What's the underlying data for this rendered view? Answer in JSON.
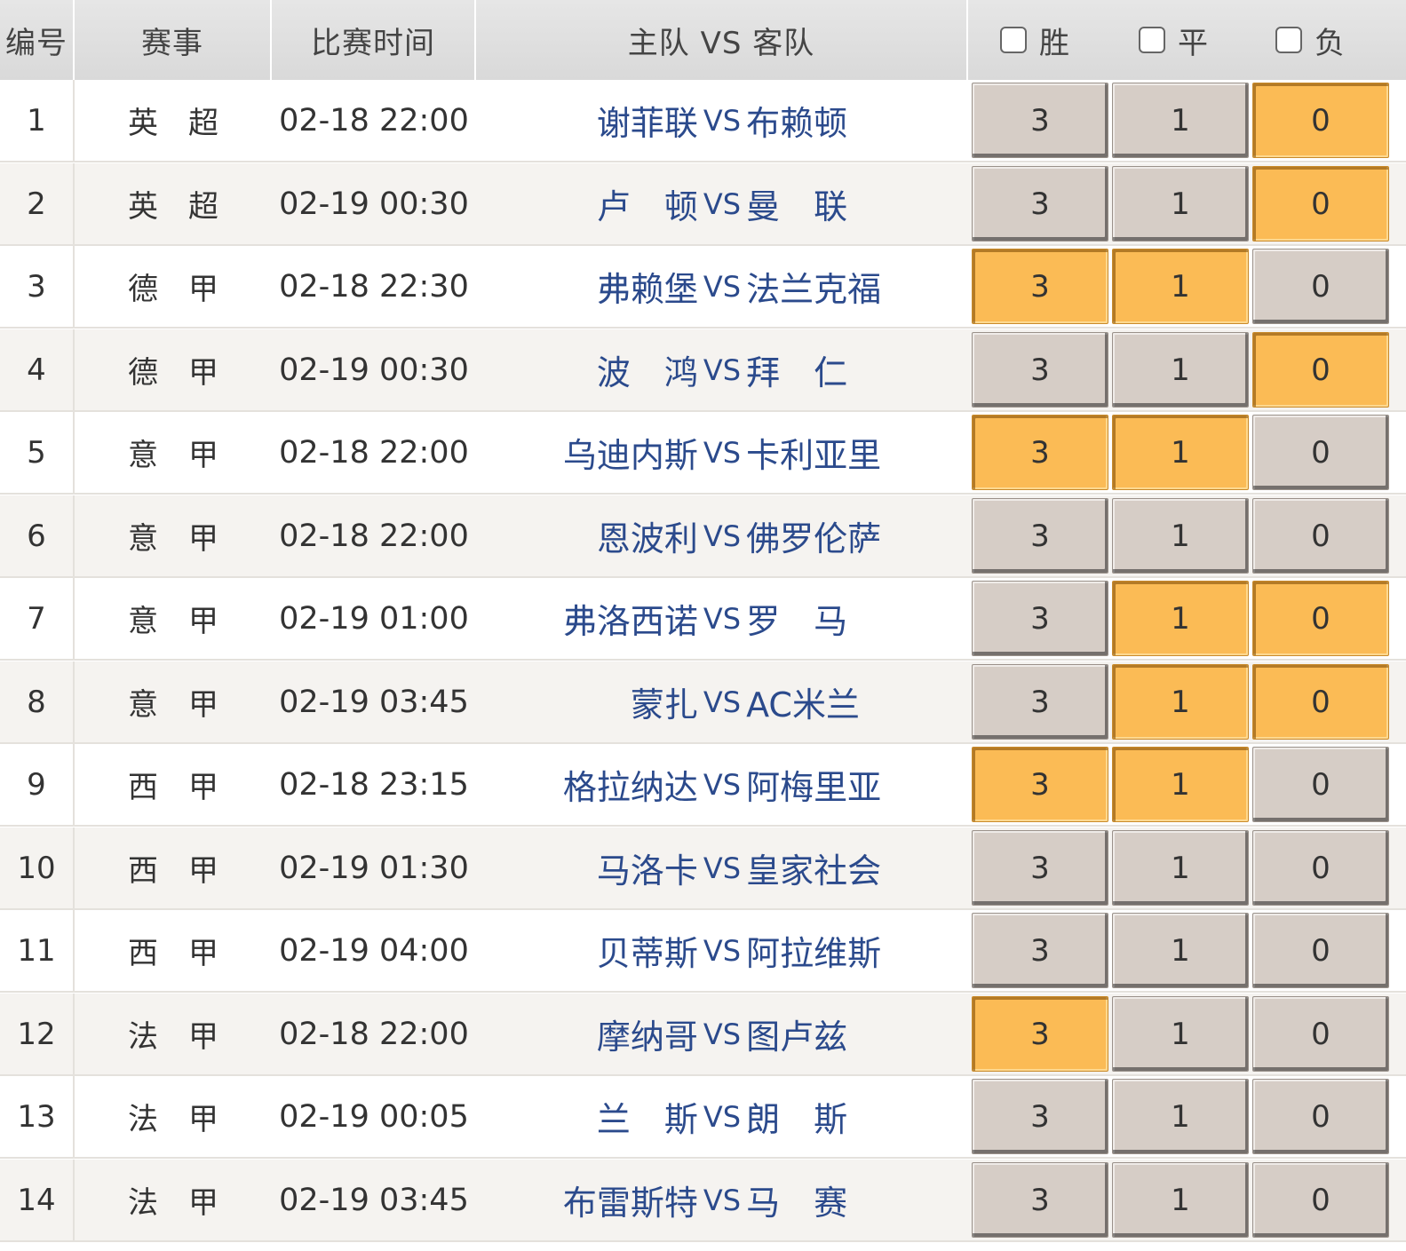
{
  "header": {
    "number": "编号",
    "league": "赛事",
    "time": "比赛时间",
    "match": "主队 VS 客队",
    "win": "胜",
    "draw": "平",
    "loss": "负"
  },
  "vs_text": "VS",
  "colors": {
    "selected": "#fbbb55",
    "unselected": "#d6cdc6",
    "team_text": "#2b4a8c",
    "header_bg": "#dcdcdc"
  },
  "rows": [
    {
      "no": "1",
      "league": "英超",
      "time": "02-18 22:00",
      "home": "谢菲联",
      "away": "布赖顿",
      "win": "3",
      "draw": "1",
      "loss": "0",
      "selected": [
        false,
        false,
        true
      ]
    },
    {
      "no": "2",
      "league": "英超",
      "time": "02-19 00:30",
      "home": "卢　顿",
      "away": "曼　联",
      "win": "3",
      "draw": "1",
      "loss": "0",
      "selected": [
        false,
        false,
        true
      ]
    },
    {
      "no": "3",
      "league": "德甲",
      "time": "02-18 22:30",
      "home": "弗赖堡",
      "away": "法兰克福",
      "win": "3",
      "draw": "1",
      "loss": "0",
      "selected": [
        true,
        true,
        false
      ]
    },
    {
      "no": "4",
      "league": "德甲",
      "time": "02-19 00:30",
      "home": "波　鸿",
      "away": "拜　仁",
      "win": "3",
      "draw": "1",
      "loss": "0",
      "selected": [
        false,
        false,
        true
      ]
    },
    {
      "no": "5",
      "league": "意甲",
      "time": "02-18 22:00",
      "home": "乌迪内斯",
      "away": "卡利亚里",
      "win": "3",
      "draw": "1",
      "loss": "0",
      "selected": [
        true,
        true,
        false
      ]
    },
    {
      "no": "6",
      "league": "意甲",
      "time": "02-18 22:00",
      "home": "恩波利",
      "away": "佛罗伦萨",
      "win": "3",
      "draw": "1",
      "loss": "0",
      "selected": [
        false,
        false,
        false
      ]
    },
    {
      "no": "7",
      "league": "意甲",
      "time": "02-19 01:00",
      "home": "弗洛西诺",
      "away": "罗　马",
      "win": "3",
      "draw": "1",
      "loss": "0",
      "selected": [
        false,
        true,
        true
      ]
    },
    {
      "no": "8",
      "league": "意甲",
      "time": "02-19 03:45",
      "home": "蒙扎",
      "away": "AC米兰",
      "win": "3",
      "draw": "1",
      "loss": "0",
      "selected": [
        false,
        true,
        true
      ]
    },
    {
      "no": "9",
      "league": "西甲",
      "time": "02-18 23:15",
      "home": "格拉纳达",
      "away": "阿梅里亚",
      "win": "3",
      "draw": "1",
      "loss": "0",
      "selected": [
        true,
        true,
        false
      ]
    },
    {
      "no": "10",
      "league": "西甲",
      "time": "02-19 01:30",
      "home": "马洛卡",
      "away": "皇家社会",
      "win": "3",
      "draw": "1",
      "loss": "0",
      "selected": [
        false,
        false,
        false
      ]
    },
    {
      "no": "11",
      "league": "西甲",
      "time": "02-19 04:00",
      "home": "贝蒂斯",
      "away": "阿拉维斯",
      "win": "3",
      "draw": "1",
      "loss": "0",
      "selected": [
        false,
        false,
        false
      ]
    },
    {
      "no": "12",
      "league": "法甲",
      "time": "02-18 22:00",
      "home": "摩纳哥",
      "away": "图卢兹",
      "win": "3",
      "draw": "1",
      "loss": "0",
      "selected": [
        true,
        false,
        false
      ]
    },
    {
      "no": "13",
      "league": "法甲",
      "time": "02-19 00:05",
      "home": "兰　斯",
      "away": "朗　斯",
      "win": "3",
      "draw": "1",
      "loss": "0",
      "selected": [
        false,
        false,
        false
      ]
    },
    {
      "no": "14",
      "league": "法甲",
      "time": "02-19 03:45",
      "home": "布雷斯特",
      "away": "马　赛",
      "win": "3",
      "draw": "1",
      "loss": "0",
      "selected": [
        false,
        false,
        false
      ]
    }
  ]
}
